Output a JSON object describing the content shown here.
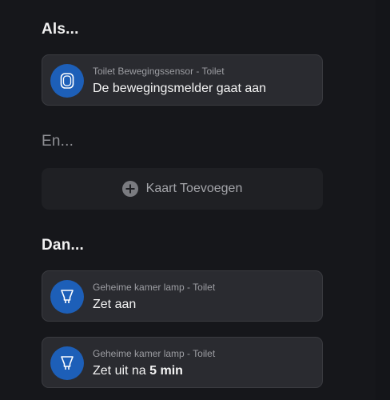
{
  "sections": {
    "if_title": "Als...",
    "and_title": "En...",
    "then_title": "Dan..."
  },
  "trigger": {
    "icon": "motion-sensor-icon",
    "subtitle": "Toilet Bewegingssensor - Toilet",
    "action": "De bewegingsmelder gaat aan"
  },
  "condition": {
    "icon": "plus-circle-icon",
    "add_label": "Kaart Toevoegen"
  },
  "actions": [
    {
      "icon": "lightbulb-icon",
      "subtitle": "Geheime kamer lamp - Toilet",
      "action": "Zet aan"
    },
    {
      "icon": "lightbulb-icon",
      "subtitle": "Geheime kamer lamp - Toilet",
      "action_prefix": "Zet uit na",
      "action_value": "5 min"
    }
  ],
  "colors": {
    "background": "#16171b",
    "card": "#2a2b30",
    "icon_accent": "#1d5fb8",
    "add_card": "#1f2024"
  }
}
